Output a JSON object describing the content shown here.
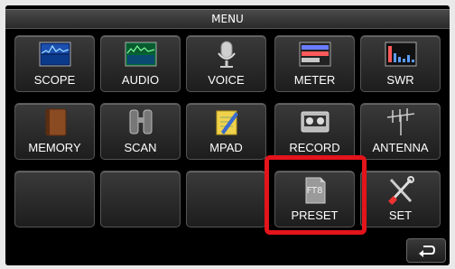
{
  "menu": {
    "title": "MENU",
    "row1": [
      "SCOPE",
      "AUDIO",
      "VOICE",
      "METER",
      "SWR"
    ],
    "row2": [
      "MEMORY",
      "SCAN",
      "MPAD",
      "RECORD",
      "ANTENNA"
    ],
    "row3": [
      "",
      "",
      "",
      "PRESET",
      "SET"
    ],
    "preset_icon_text": "FT8"
  },
  "icons": {
    "scope": "spectrum-scope-icon",
    "audio": "audio-spectrum-icon",
    "voice": "microphone-icon",
    "meter": "meter-icon",
    "swr": "swr-graph-icon",
    "memory": "memory-book-icon",
    "scan": "binoculars-icon",
    "mpad": "memo-pad-icon",
    "record": "tape-recorder-icon",
    "antenna": "antenna-icon",
    "preset": "preset-document-icon",
    "set": "tools-icon",
    "back": "return-arrow-icon"
  },
  "colors": {
    "highlight": "#e3141b",
    "screen_bg": "#000000"
  }
}
